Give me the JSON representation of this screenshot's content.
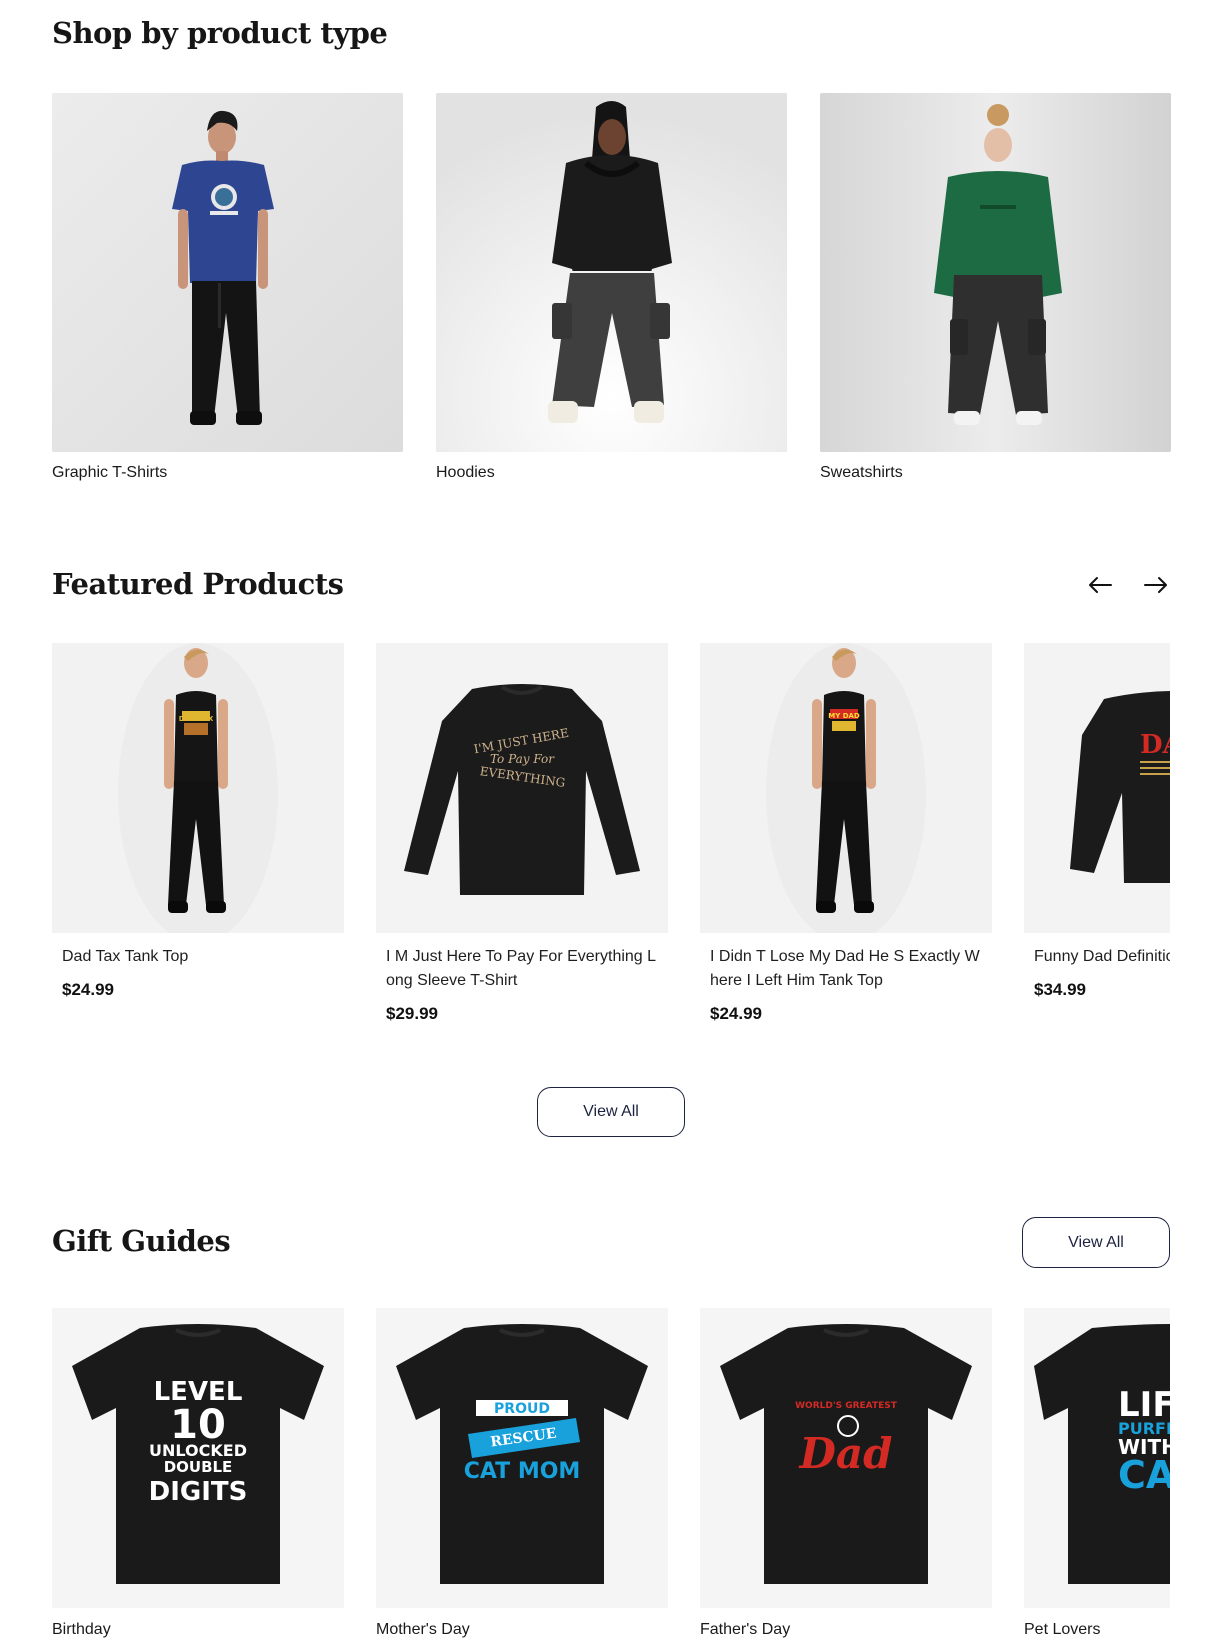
{
  "shop_by_type": {
    "title": "Shop by product type",
    "items": [
      {
        "label": "Graphic T-Shirts"
      },
      {
        "label": "Hoodies"
      },
      {
        "label": "Sweatshirts"
      }
    ]
  },
  "featured": {
    "title": "Featured Products",
    "prev_icon": "arrow-left-icon",
    "next_icon": "arrow-right-icon",
    "view_all_label": "View All",
    "products": [
      {
        "name": "Dad Tax Tank Top",
        "price": "$24.99",
        "print_text": "DAD TAX"
      },
      {
        "name": "I M Just Here To Pay For Everything Long Sleeve T-Shirt",
        "price": "$29.99",
        "print_text": [
          "I'M JUST HERE",
          "To Pay For",
          "EVERYTHING"
        ]
      },
      {
        "name": "I Didn T Lose My Dad He S Exactly Where I Left Him Tank Top",
        "price": "$24.99",
        "print_text": "MY DAD"
      },
      {
        "name": "Funny Dad Definition Sweatshirt",
        "price": "$34.99",
        "print_text": "DA"
      }
    ]
  },
  "gift_guides": {
    "title": "Gift Guides",
    "view_all_label": "View All",
    "items": [
      {
        "label": "Birthday",
        "print_text": [
          "LEVEL",
          "10",
          "UNLOCKED",
          "DOUBLE",
          "DIGITS"
        ]
      },
      {
        "label": "Mother's Day",
        "print_text": [
          "PROUD",
          "RESCUE",
          "CAT MOM"
        ]
      },
      {
        "label": "Father's Day",
        "print_text": [
          "WORLD'S GREATEST",
          "Dad"
        ]
      },
      {
        "label": "Pet Lovers",
        "print_text": [
          "LIFE",
          "PURFE",
          "WITH",
          "CA"
        ]
      }
    ]
  },
  "colors": {
    "accent": "#1c2340",
    "tee_blue": "#2e4591",
    "sweat_green": "#1d6b42",
    "print_red": "#d42a24",
    "print_blue": "#19a1dc"
  }
}
